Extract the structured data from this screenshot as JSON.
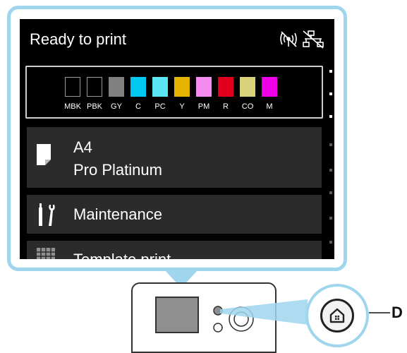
{
  "screen": {
    "status_title": "Ready to print",
    "status_icons": [
      "wireless-off-icon",
      "wired-lan-off-icon"
    ]
  },
  "ink": {
    "tanks": [
      {
        "label": "MBK",
        "color": "#000000"
      },
      {
        "label": "PBK",
        "color": "#000000"
      },
      {
        "label": "GY",
        "color": "#808080"
      },
      {
        "label": "C",
        "color": "#00c8f0"
      },
      {
        "label": "PC",
        "color": "#5ce6f5"
      },
      {
        "label": "Y",
        "color": "#e6b400"
      },
      {
        "label": "PM",
        "color": "#f58cf0"
      },
      {
        "label": "R",
        "color": "#e0001e"
      },
      {
        "label": "CO",
        "color": "#d9d27a"
      },
      {
        "label": "M",
        "color": "#f000e6"
      }
    ]
  },
  "menu": {
    "paper": {
      "size": "A4",
      "type": "Pro Platinum"
    },
    "maintenance": "Maintenance",
    "partial_item": "Template print"
  },
  "callout": {
    "label": "D"
  },
  "colors": {
    "accent": "#9fd6ee",
    "item_bg": "#2b2b2b"
  }
}
